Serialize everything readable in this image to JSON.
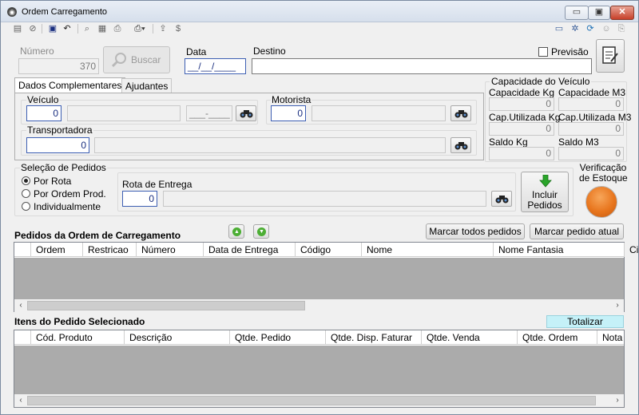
{
  "window": {
    "title": "Ordem Carregamento",
    "app_icon": "app-icon"
  },
  "window_controls": {
    "minimize": "▭",
    "restore": "▣",
    "close": "✕"
  },
  "toolbar": {
    "left_icons": [
      "new-icon",
      "cancel-icon",
      "save-icon",
      "undo-icon",
      "find-icon",
      "grid-icon",
      "print-icon",
      "printer-dropdown-icon",
      "export-icon",
      "money-icon"
    ],
    "right_icons": [
      "window-icon",
      "settings-icon",
      "refresh-icon",
      "user-icon",
      "attach-icon"
    ]
  },
  "header": {
    "numero_label": "Número",
    "numero_value": "370",
    "buscar_label": "Buscar",
    "data_label": "Data",
    "data_value": "__/__/____",
    "destino_label": "Destino",
    "destino_value": "",
    "previsao_label": "Previsão",
    "previsao_checked": false
  },
  "tabs": [
    {
      "label": "Dados Complementares",
      "active": true
    },
    {
      "label": "Ajudantes",
      "active": false
    }
  ],
  "dados": {
    "veiculo_label": "Veículo",
    "veiculo_value": "0",
    "veiculo_desc": "",
    "veiculo_placa": "___-____",
    "motorista_label": "Motorista",
    "motorista_value": "0",
    "motorista_desc": "",
    "transportadora_label": "Transportadora",
    "transportadora_value": "0",
    "transportadora_desc": ""
  },
  "capacidade": {
    "title": "Capacidade do Veículo",
    "capacidade_kg_label": "Capacidade Kg",
    "capacidade_kg_value": "0",
    "capacidade_m3_label": "Capacidade M3",
    "capacidade_m3_value": "0",
    "cap_utilizada_kg_label": "Cap.Utilizada Kg",
    "cap_utilizada_kg_value": "0",
    "cap_utilizada_m3_label": "Cap.Utilizada M3",
    "cap_utilizada_m3_value": "0",
    "saldo_kg_label": "Saldo Kg",
    "saldo_kg_value": "0",
    "saldo_m3_label": "Saldo M3",
    "saldo_m3_value": "0"
  },
  "selecao": {
    "title": "Seleção de Pedidos",
    "options": [
      "Por Rota",
      "Por Ordem Prod.",
      "Individualmente"
    ],
    "selected_index": 0,
    "rota_label": "Rota de Entrega",
    "rota_value": "0",
    "rota_desc": "",
    "incluir_line1": "Incluir",
    "incluir_line2": "Pedidos",
    "verificacao_line1": "Verificação",
    "verificacao_line2": "de Estoque",
    "estoque_status_color": "#e8761e"
  },
  "pedidos": {
    "title": "Pedidos da Ordem de Carregamento",
    "marcar_todos": "Marcar todos pedidos",
    "marcar_atual": "Marcar pedido atual",
    "columns": [
      "Ordem",
      "Restricao",
      "Número",
      "Data de Entrega",
      "Código",
      "Nome",
      "Nome Fantasia",
      "Ci"
    ]
  },
  "itens": {
    "title": "Itens do Pedido Selecionado",
    "totalizar": "Totalizar",
    "columns": [
      "Cód. Produto",
      "Descrição",
      "Qtde. Pedido",
      "Qtde. Disp. Faturar",
      "Qtde. Venda",
      "Qtde. Ordem",
      "Nota Fisc"
    ]
  },
  "colors": {
    "accent_blue": "#3d5fb3",
    "grid_empty": "#ababab",
    "totalizar_bg": "#c5f1f8",
    "incluir_arrow": "#2aa52a"
  }
}
